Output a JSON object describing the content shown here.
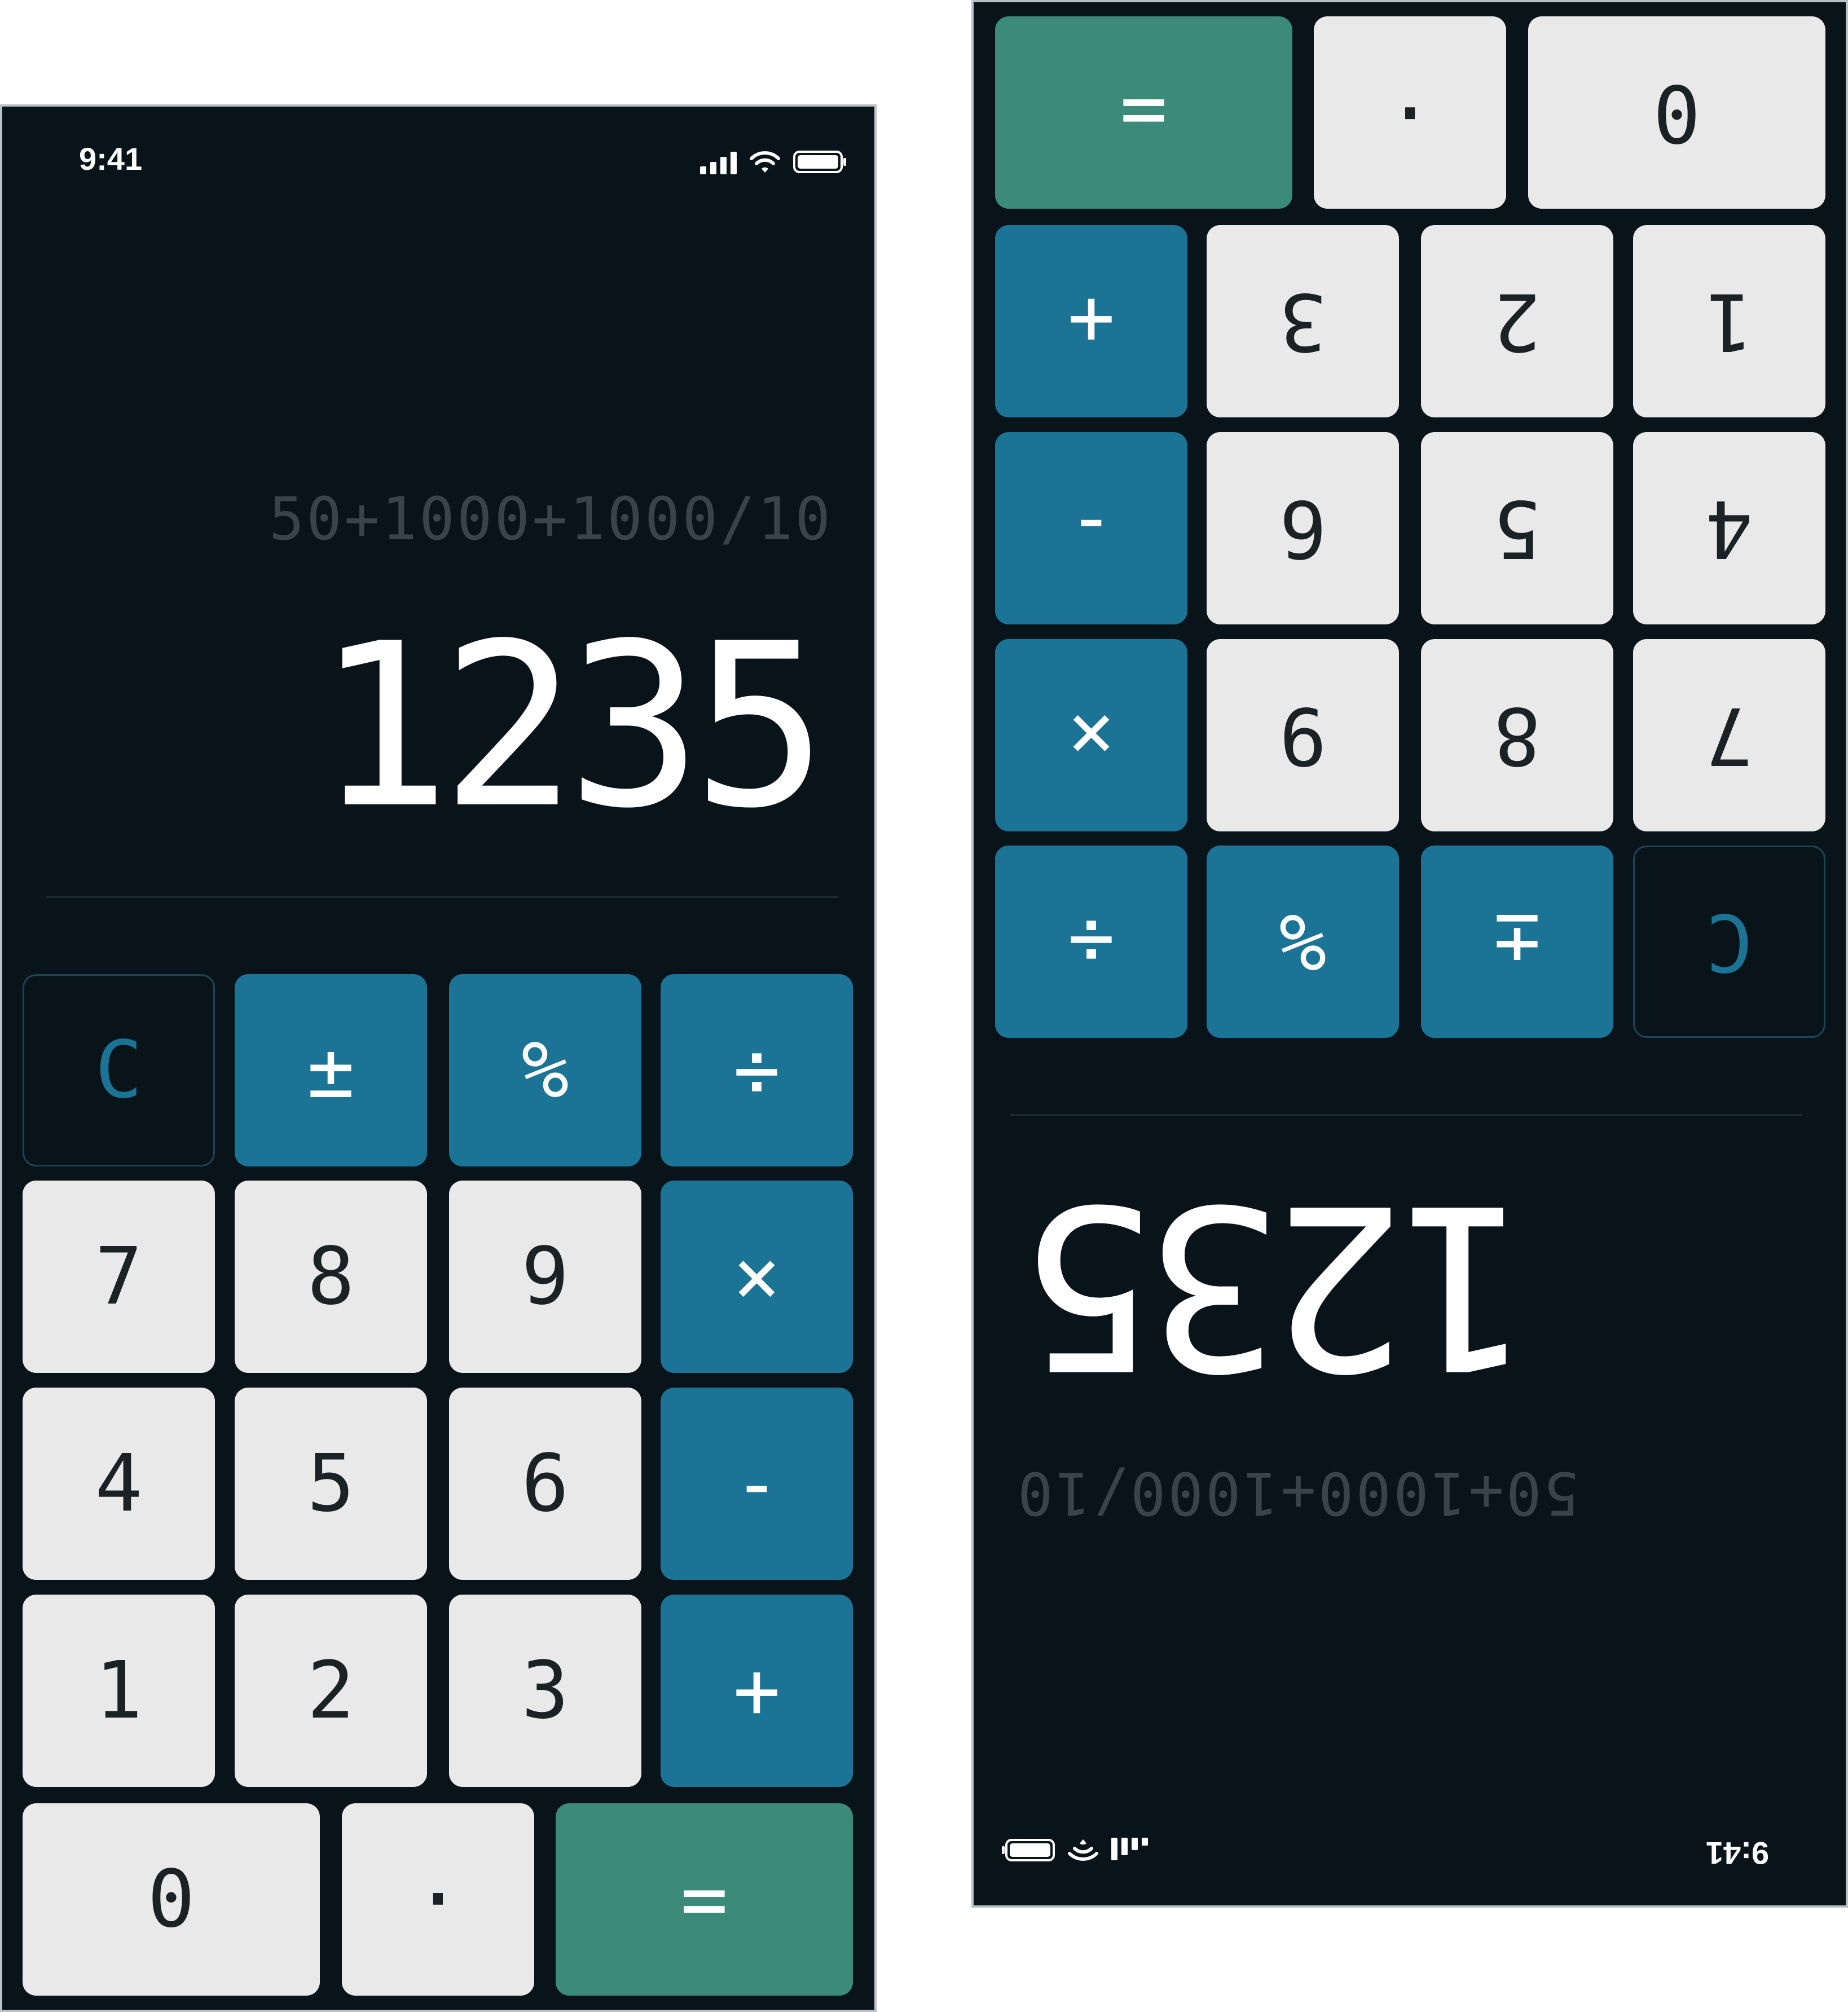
{
  "status": {
    "time": "9:41"
  },
  "display": {
    "expression": "50+1000+1000/10",
    "result": "1235"
  },
  "keys": {
    "clear": "C",
    "plus_minus": "±",
    "percent": "%",
    "divide": "÷",
    "seven": "7",
    "eight": "8",
    "nine": "9",
    "multiply": "×",
    "four": "4",
    "five": "5",
    "six": "6",
    "minus": "-",
    "one": "1",
    "two": "2",
    "three": "3",
    "plus": "+",
    "zero": "0",
    "decimal": "·",
    "equals": "="
  },
  "icons": [
    "cellular-signal-icon",
    "wifi-icon",
    "battery-icon"
  ],
  "colors": {
    "background": "#09131a",
    "number_key": "#e9e9e9",
    "operator_key": "#1b7495",
    "equals_key": "#3c8a7a",
    "expression_text": "#38434a",
    "result_text": "#ffffff"
  }
}
